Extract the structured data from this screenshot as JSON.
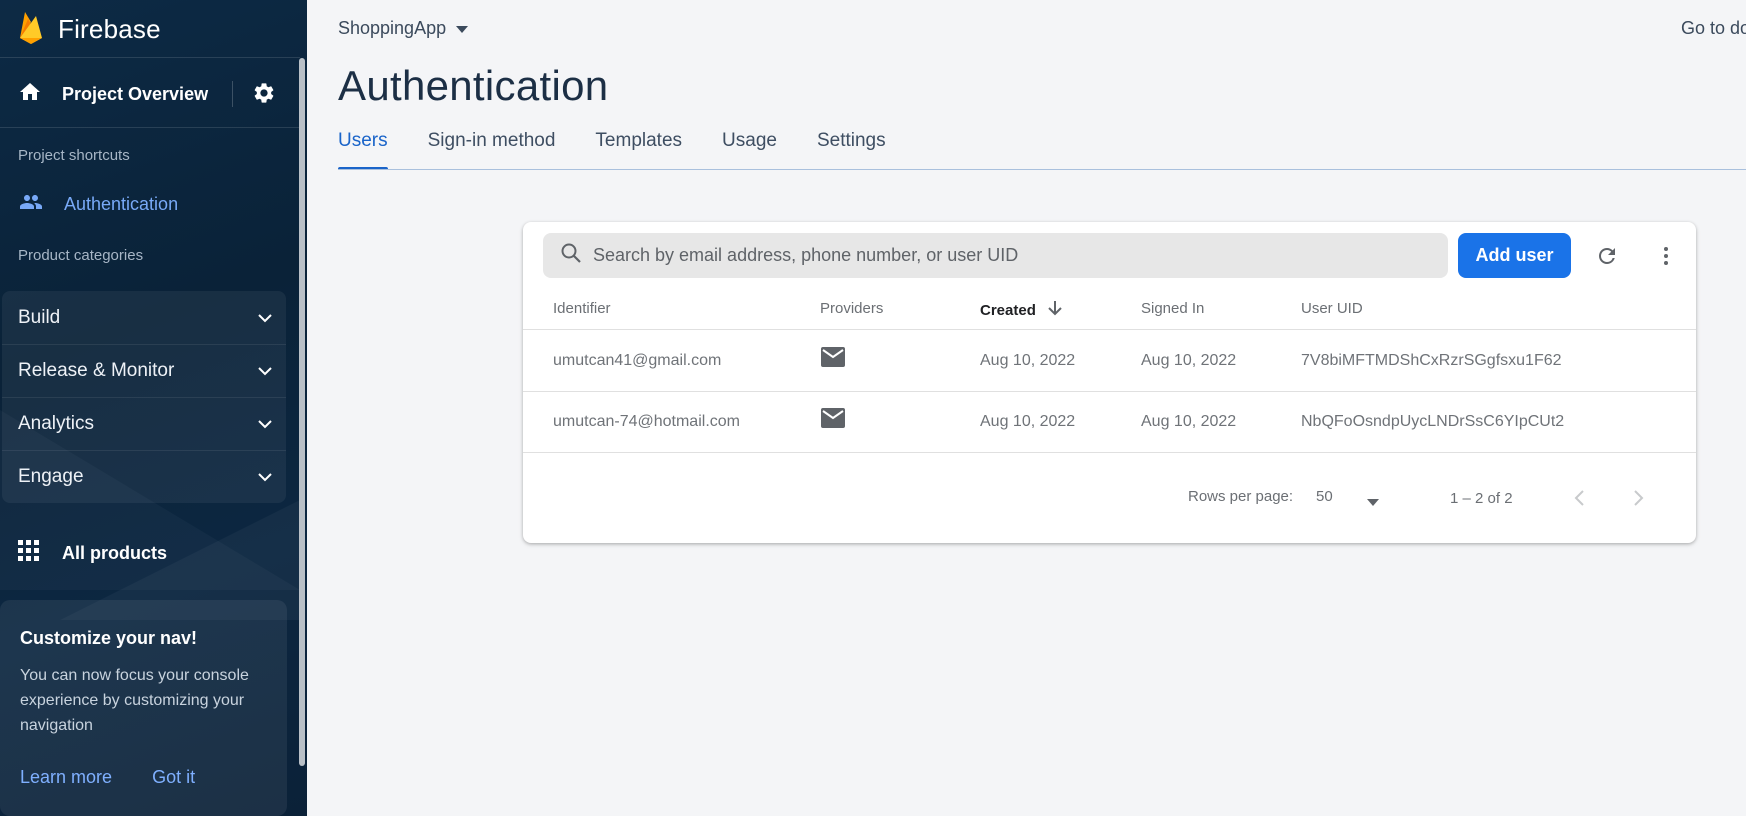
{
  "sidebar": {
    "brand": "Firebase",
    "project_overview": "Project Overview",
    "shortcuts_label": "Project shortcuts",
    "shortcut_auth": "Authentication",
    "categories_label": "Product categories",
    "categories": [
      {
        "label": "Build"
      },
      {
        "label": "Release & Monitor"
      },
      {
        "label": "Analytics"
      },
      {
        "label": "Engage"
      }
    ],
    "all_products": "All products",
    "nav_card": {
      "title": "Customize your nav!",
      "body": "You can now focus your console experience by customizing your navigation",
      "learn_more": "Learn more",
      "got_it": "Got it"
    }
  },
  "header": {
    "project": "ShoppingApp",
    "goto_docs": "Go to do"
  },
  "page_title": "Authentication",
  "tabs": [
    {
      "label": "Users",
      "active": true
    },
    {
      "label": "Sign-in method"
    },
    {
      "label": "Templates"
    },
    {
      "label": "Usage"
    },
    {
      "label": "Settings"
    }
  ],
  "users": {
    "search_placeholder": "Search by email address, phone number, or user UID",
    "add_user": "Add user",
    "columns": {
      "identifier": "Identifier",
      "providers": "Providers",
      "created": "Created",
      "signed_in": "Signed In",
      "uid": "User UID"
    },
    "rows": [
      {
        "identifier": "umutcan41@gmail.com",
        "provider": "email-icon",
        "created": "Aug 10, 2022",
        "signed_in": "Aug 10, 2022",
        "uid": "7V8biMFTMDShCxRzrSGgfsxu1F62"
      },
      {
        "identifier": "umutcan-74@hotmail.com",
        "provider": "email-icon",
        "created": "Aug 10, 2022",
        "signed_in": "Aug 10, 2022",
        "uid": "NbQFoOsndpUycLNDrSsC6YIpCUt2"
      }
    ],
    "pagination": {
      "rows_per_page_label": "Rows per page:",
      "rows_per_page": "50",
      "range": "1 – 2 of 2"
    }
  },
  "colors": {
    "accent": "#1a73e8",
    "sidebar_bg": "#0b2239",
    "active_tab": "#1a64c9"
  }
}
